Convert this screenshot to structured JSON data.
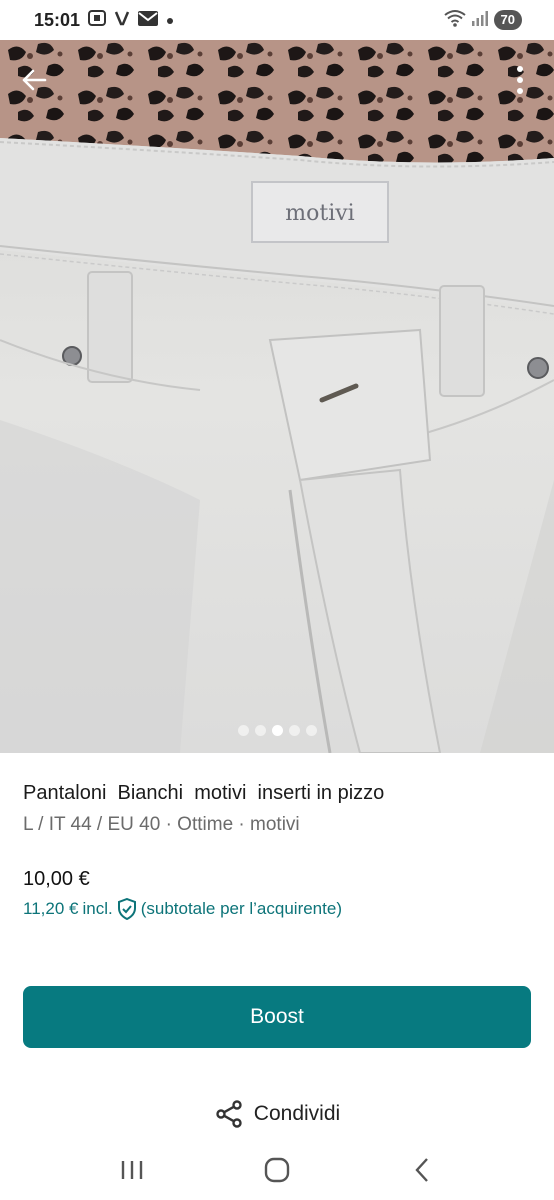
{
  "status_bar": {
    "time": "15:01",
    "battery": "70",
    "notification_icons": [
      "screenshot-icon",
      "v-app-icon",
      "mail-icon",
      "dot-icon"
    ],
    "right_icons": [
      "wifi-icon",
      "signal-icon"
    ]
  },
  "photo": {
    "label_text": "motivi",
    "carousel": {
      "count": 5,
      "active_index": 2
    }
  },
  "listing": {
    "title": "Pantaloni  Bianchi  motivi  inserti in pizzo",
    "details": "L / IT 44 / EU 40 · Ottime · motivi",
    "price": "10,00 €",
    "buyer_price": "11,20 €",
    "incl_label": "incl.",
    "buyer_note": "(subtotale per l’acquirente)"
  },
  "actions": {
    "boost_label": "Boost",
    "share_label": "Condividi"
  },
  "colors": {
    "accent": "#077a80",
    "accent_text": "#0d7479"
  }
}
